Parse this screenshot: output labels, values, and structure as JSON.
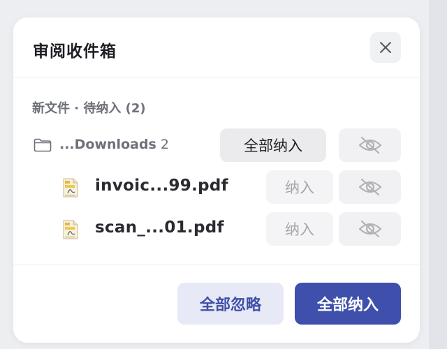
{
  "dialog": {
    "title": "审阅收件箱",
    "section_label": "新文件 · 待纳入 (2)"
  },
  "folder": {
    "name": "...Downloads",
    "count": "2",
    "accept_all_label": "全部纳入",
    "icon": "folder-icon"
  },
  "files": [
    {
      "name": "invoic...99.pdf",
      "accept_label": "纳入",
      "icon": "pdf-file-icon"
    },
    {
      "name": "scan_...01.pdf",
      "accept_label": "纳入",
      "icon": "pdf-file-icon"
    }
  ],
  "footer": {
    "ignore_all_label": "全部忽略",
    "accept_all_label": "全部纳入"
  },
  "colors": {
    "primary": "#3e50ac",
    "secondary_bg": "#e7e9f6",
    "secondary_text": "#3f4fa8"
  }
}
